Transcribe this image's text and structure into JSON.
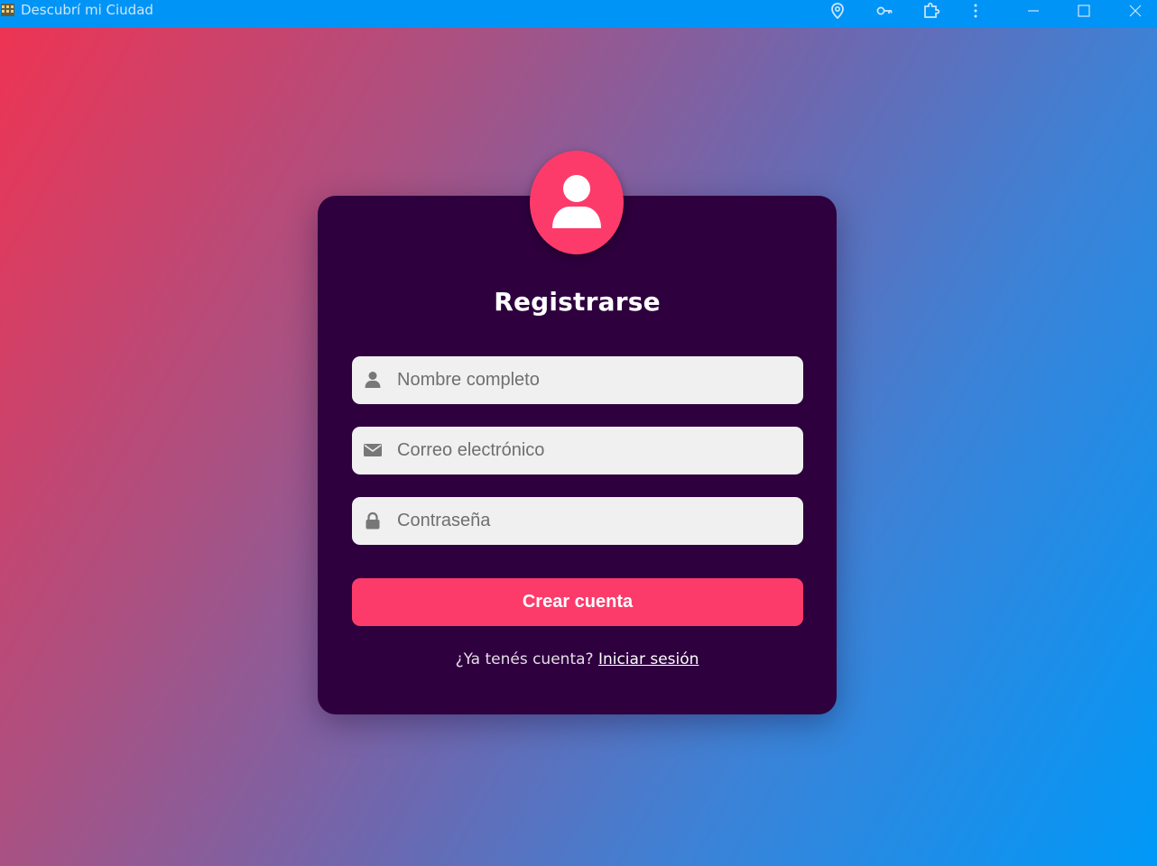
{
  "window": {
    "title": "Descubrí mi Ciudad",
    "toolbar_icons": [
      "location-pin-icon",
      "key-icon",
      "extension-icon",
      "more-vert-icon"
    ],
    "controls": [
      "minimize-icon",
      "maximize-icon",
      "close-icon"
    ]
  },
  "form": {
    "heading": "Registrarse",
    "fields": {
      "name": {
        "placeholder": "Nombre completo",
        "value": "",
        "icon": "user-icon"
      },
      "email": {
        "placeholder": "Correo electrónico",
        "value": "",
        "icon": "envelope-icon"
      },
      "password": {
        "placeholder": "Contraseña",
        "value": "",
        "icon": "lock-icon"
      }
    },
    "submit_label": "Crear cuenta",
    "footer_text": "¿Ya tenés cuenta?",
    "login_link": "Iniciar sesión"
  },
  "colors": {
    "titlebar": "#0094f7",
    "card": "#2e003e",
    "accent": "#fd3b6b",
    "input_bg": "#f0f0f0",
    "gradient_start": "#ee3453",
    "gradient_end": "#0099f8"
  }
}
